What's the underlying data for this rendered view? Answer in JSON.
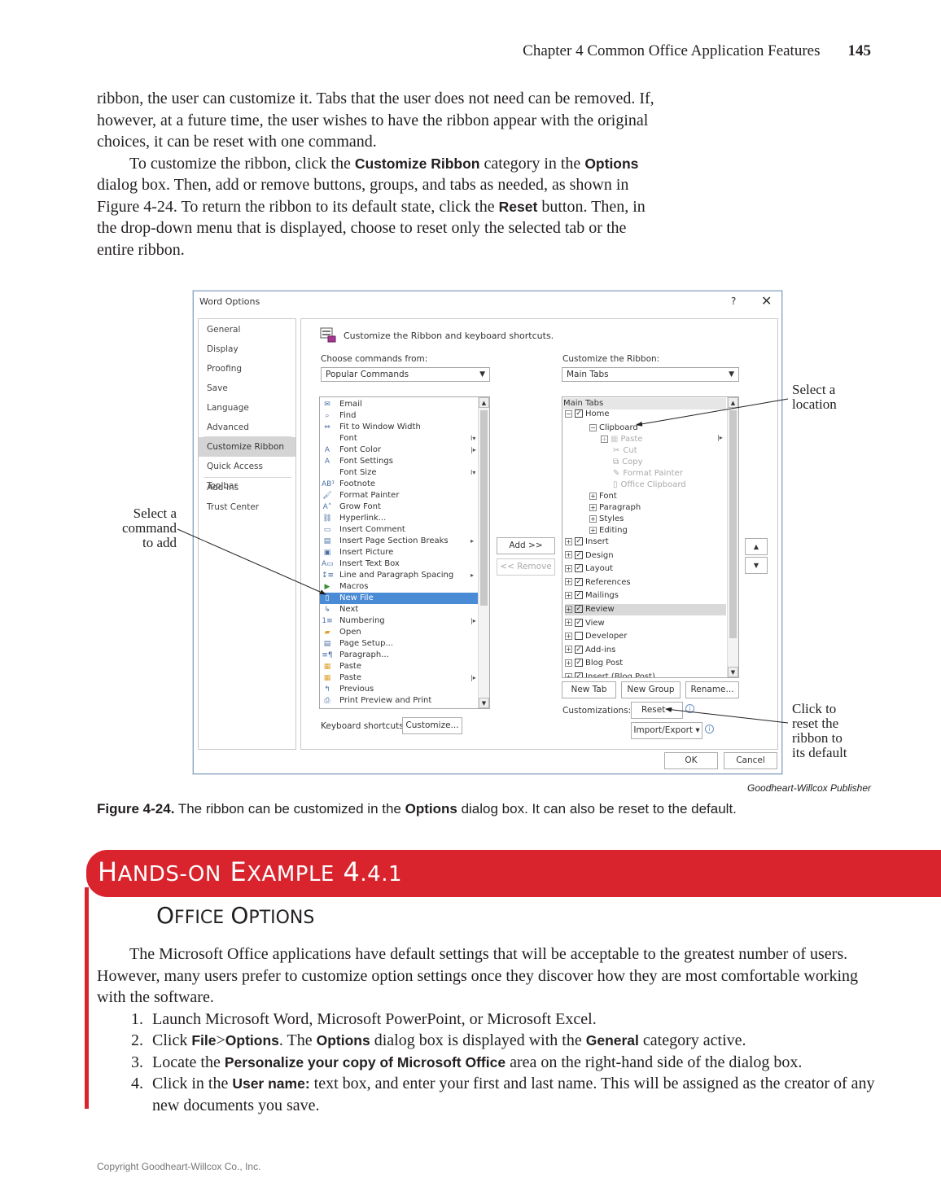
{
  "running_head": {
    "chapter": "Chapter 4  Common Office Application Features",
    "page": "145"
  },
  "intro": {
    "p1": "ribbon, the user can customize it. Tabs that the user does not need can be removed. If, however, at a future time, the user wishes to have the ribbon appear with the original choices, it can be reset with one command.",
    "p2_a": "To customize the ribbon, click the ",
    "p2_b": "Customize Ribbon",
    "p2_c": " category in the ",
    "p2_d": "Options",
    "p2_e": " dialog box. Then, add or remove buttons, groups, and tabs as needed, as shown in Figure 4-24. To return the ribbon to its default state, click the ",
    "p2_f": "Reset",
    "p2_g": " button. Then, in the drop-down menu that is displayed, choose to reset only the selected tab or the entire ribbon."
  },
  "dialog": {
    "title": "Word Options",
    "help": "?",
    "close": "✕",
    "categories": [
      "General",
      "Display",
      "Proofing",
      "Save",
      "Language",
      "Advanced",
      "Customize Ribbon",
      "Quick Access Toolbar",
      "Add-ins",
      "Trust Center"
    ],
    "heading": "Customize the Ribbon and keyboard shortcuts.",
    "choose_label": "Choose commands from:",
    "choose_value": "Popular Commands",
    "ribbon_label": "Customize the Ribbon:",
    "ribbon_value": "Main Tabs",
    "commands": [
      "Email",
      "Find",
      "Fit to Window Width",
      "Font",
      "Font Color",
      "Font Settings",
      "Font Size",
      "Footnote",
      "Format Painter",
      "Grow Font",
      "Hyperlink...",
      "Insert Comment",
      "Insert Page  Section Breaks",
      "Insert Picture",
      "Insert Text Box",
      "Line and Paragraph Spacing",
      "Macros",
      "New File",
      "Next",
      "Numbering",
      "Open",
      "Page Setup...",
      "Paragraph...",
      "Paste",
      "Paste",
      "Previous",
      "Print Preview and Print"
    ],
    "selected_command": "New File",
    "tree_header": "Main Tabs",
    "tree": {
      "home": "Home",
      "clipboard": "Clipboard",
      "paste": "Paste",
      "cut": "Cut",
      "copy": "Copy",
      "format_painter": "Format Painter",
      "office_clipboard": "Office Clipboard",
      "font": "Font",
      "paragraph": "Paragraph",
      "styles": "Styles",
      "editing": "Editing",
      "tabs": [
        {
          "label": "Insert",
          "checked": true
        },
        {
          "label": "Design",
          "checked": true
        },
        {
          "label": "Layout",
          "checked": true
        },
        {
          "label": "References",
          "checked": true
        },
        {
          "label": "Mailings",
          "checked": true
        },
        {
          "label": "Review",
          "checked": true
        },
        {
          "label": "View",
          "checked": true
        },
        {
          "label": "Developer",
          "checked": false
        },
        {
          "label": "Add-ins",
          "checked": true
        },
        {
          "label": "Blog Post",
          "checked": true
        },
        {
          "label": "Insert (Blog Post)",
          "checked": true
        }
      ]
    },
    "add_btn": "Add >>",
    "remove_btn": "<< Remove",
    "new_tab": "New Tab",
    "new_group": "New Group",
    "rename": "Rename...",
    "customizations_label": "Customizations:",
    "reset": "Reset ▾",
    "import_export": "Import/Export ▾",
    "keyboard_label": "Keyboard shortcuts:",
    "customize_btn": "Customize...",
    "ok": "OK",
    "cancel": "Cancel"
  },
  "callouts": {
    "location": "Select a location",
    "command": "Select a command to add",
    "reset": "Click to reset the ribbon to its default"
  },
  "credit": "Goodheart-Willcox Publisher",
  "caption": {
    "label": "Figure 4-24.",
    "t1": " The ribbon can be customized in the ",
    "t2": "Options",
    "t3": " dialog box. It can also be reset to the default."
  },
  "banner": {
    "title": "Hands-On Example 4.4.1"
  },
  "subhead": "Office Options",
  "hands_on": {
    "intro": "The Microsoft Office applications have default settings that will be acceptable to the greatest number of users. However, many users prefer to customize option settings once they discover how they are most comfortable working with the software.",
    "s1": "Launch Microsoft Word, Microsoft PowerPoint, or Microsoft Excel.",
    "s2_a": "Click ",
    "s2_b": "File",
    "s2_c": ">",
    "s2_d": "Options",
    "s2_e": ". The ",
    "s2_f": "Options",
    "s2_g": " dialog box is displayed with the ",
    "s2_h": "General",
    "s2_i": " category active.",
    "s3_a": "Locate the ",
    "s3_b": "Personalize your copy of Microsoft Office",
    "s3_c": " area on the right-hand side of the dialog box.",
    "s4_a": "Click in the ",
    "s4_b": "User name:",
    "s4_c": " text box, and enter your first and last name. This will be assigned as the creator of any new documents you save."
  },
  "copyright": "Copyright Goodheart-Willcox Co., Inc."
}
